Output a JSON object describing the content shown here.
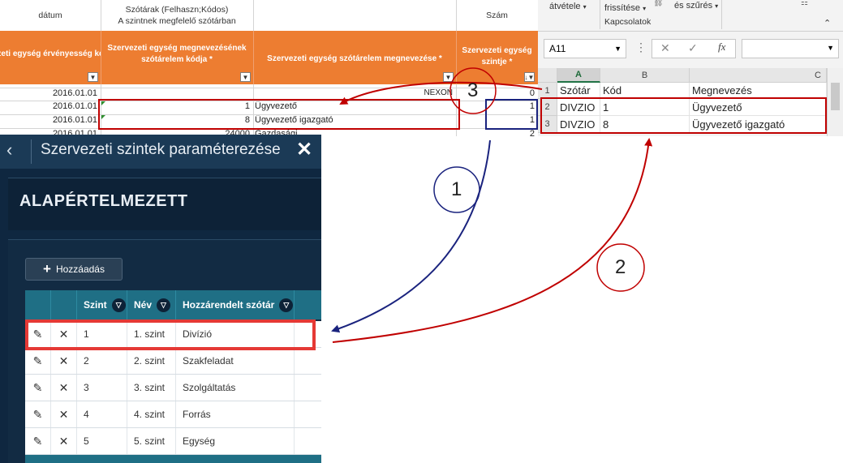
{
  "sheet": {
    "top_headers": {
      "col1": "dátum",
      "col2_line1": "Szótárak (Felhaszn;Kódos)",
      "col2_line2": "A szintnek megfelelő szótárban",
      "col4": "Szám"
    },
    "orange_headers": {
      "col1": "Szervezeti egység érvényesség kezdete *",
      "col2": "Szervezeti egység megnevezésének szótárelem kódja *",
      "col3": "Szervezeti egység szótárelem megnevezése *",
      "col4": "Szervezeti egység szintje *"
    },
    "rows": [
      {
        "date": "2016.01.01",
        "code": "",
        "name": "NEXON",
        "level": "0"
      },
      {
        "date": "2016.01.01",
        "code": "1",
        "name": "Ügyvezető",
        "level": "1"
      },
      {
        "date": "2016.01.01",
        "code": "8",
        "name": "Ügyvezető igazgató",
        "level": "1"
      },
      {
        "date": "2016.01.01",
        "code": "24000",
        "name": "Gazdasági",
        "level": "2"
      }
    ]
  },
  "excel": {
    "ribbon": {
      "item1": "átvétele",
      "item2": "frissítése",
      "item3": "és szűrés",
      "group_label": "Kapcsolatok"
    },
    "name_box": "A11",
    "fx_label": "fx",
    "columns": [
      "A",
      "B",
      "C"
    ],
    "rows": [
      {
        "num": "1",
        "a": "Szótár",
        "b": "Kód",
        "c": "Megnevezés"
      },
      {
        "num": "2",
        "a": "DIVZIO",
        "b": "1",
        "c": "Ügyvezető"
      },
      {
        "num": "3",
        "a": "DIVZIO",
        "b": "8",
        "c": "Ügyvezető igazgató"
      }
    ]
  },
  "app": {
    "title": "Szervezeti szintek paraméterezése",
    "page_header": "ALAPÉRTELMEZETT",
    "add_button": "Hozzáadás",
    "grid_headers": [
      "Szint",
      "Név",
      "Hozzárendelt szótár"
    ],
    "grid_rows": [
      {
        "level": "1",
        "name": "1. szint",
        "dict": "Divízió"
      },
      {
        "level": "2",
        "name": "2. szint",
        "dict": "Szakfeladat"
      },
      {
        "level": "3",
        "name": "3. szint",
        "dict": "Szolgáltatás"
      },
      {
        "level": "4",
        "name": "4. szint",
        "dict": "Forrás"
      },
      {
        "level": "5",
        "name": "5. szint",
        "dict": "Egység"
      }
    ]
  },
  "annotations": {
    "label1": "1",
    "label2": "2",
    "label3": "3"
  },
  "colors": {
    "orange_header": "#ed7d31",
    "grid_header": "#1f6f85",
    "app_background": "#0f2740",
    "annotation_red": "#c00000",
    "annotation_blue": "#1a237e"
  }
}
